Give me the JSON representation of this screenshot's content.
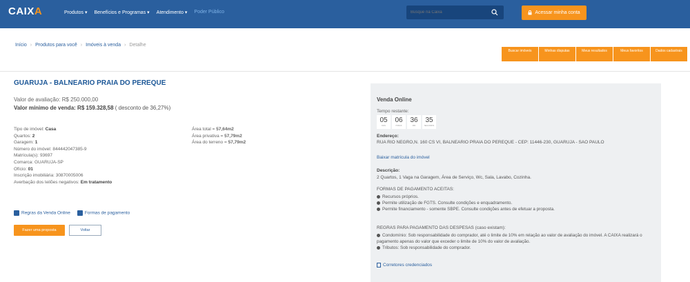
{
  "header": {
    "logo": "CAIX",
    "logo_accent": "A",
    "nav": [
      "Produtos ▾",
      "Benefícios e Programas ▾",
      "Atendimento ▾",
      "Poder Público"
    ],
    "search_placeholder": "Busque na Caixa",
    "access_label": "Acessar minha conta"
  },
  "breadcrumb": [
    "Início",
    "Produtos para você",
    "Imóveis à venda",
    "Detalhe"
  ],
  "quick_buttons": [
    "Buscar imóveis",
    "Minhas disputas",
    "Meus resultados",
    "Meus favoritos",
    "Dados cadastrais"
  ],
  "property": {
    "title": "GUARUJA - BALNEARIO PRAIA DO PEREQUE",
    "valor_avaliacao_label": "Valor de avaliação:",
    "valor_avaliacao": "R$ 250.000,00",
    "valor_minimo_label": "Valor mínimo de venda:",
    "valor_minimo": "R$ 159.328,58",
    "desconto": "( desconto de 36,27%)",
    "left_details": [
      {
        "label": "Tipo de imóvel:",
        "value": "Casa"
      },
      {
        "label": "Quartos:",
        "value": "2"
      },
      {
        "label": "Garagem:",
        "value": "1"
      },
      {
        "label": "Número do imóvel:",
        "value": "844442047385-9"
      },
      {
        "label": "Matrícula(s):",
        "value": "93697"
      },
      {
        "label": "Comarca:",
        "value": "GUARUJA-SP"
      },
      {
        "label": "Ofício:",
        "value": "01"
      },
      {
        "label": "Inscrição imobiliária:",
        "value": "30870005006"
      },
      {
        "label": "Averbação dos leilões negativos:",
        "value": "Em tratamento"
      }
    ],
    "right_details": [
      {
        "label": "Área total =",
        "value": "57,64m2"
      },
      {
        "label": "Área privativa =",
        "value": "57,79m2"
      },
      {
        "label": "Área do terreno =",
        "value": "57,79m2"
      }
    ],
    "link_rules": "Regras da Venda Online",
    "link_payment": "Formas de pagamento",
    "btn_proposal": "Fazer uma proposta",
    "btn_back": "Voltar"
  },
  "panel": {
    "title": "Venda Online",
    "time_label": "Tempo restante:",
    "timer": [
      {
        "value": "05",
        "unit": "DIAS"
      },
      {
        "value": "06",
        "unit": "HORAS"
      },
      {
        "value": "36",
        "unit": "MIN"
      },
      {
        "value": "35",
        "unit": "SEGUNDOS"
      }
    ],
    "address_label": "Endereço:",
    "address": "RUA RIO NEGRO,N. 160 CS VI, BALNEARIO PRAIA DO PEREQUE - CEP: 11446-230, GUARUJA - SAO PAULO",
    "download_link": "Baixar matrícula do imóvel",
    "desc_label": "Descrição:",
    "desc": "2 Quartos, 1 Vaga na Garagem, Área de Serviço, Wc, Sala, Lavabo, Cozinha.",
    "payment_heading": "FORMAS DE PAGAMENTO ACEITAS:",
    "payment_items": [
      "Recursos próprios.",
      "Permite utilização de FGTS. Consulte condições e enquadramento.",
      "Permite financiamento - somente SBPE. Consulte condições antes de efetuar a proposta."
    ],
    "rules_heading": "REGRAS PARA PAGAMENTO DAS DESPESAS (caso existam):",
    "rules_items": [
      "Condomínio: Sob responsabilidade do comprador, até o limite de 10% em relação ao valor de avaliação do imóvel. A CAIXA realizará o pagamento apenas do valor que exceder o limite de 10% do valor de avaliação.",
      "Tributos: Sob responsabilidade do comprador."
    ],
    "brokers_link": "Corretores credenciados"
  }
}
